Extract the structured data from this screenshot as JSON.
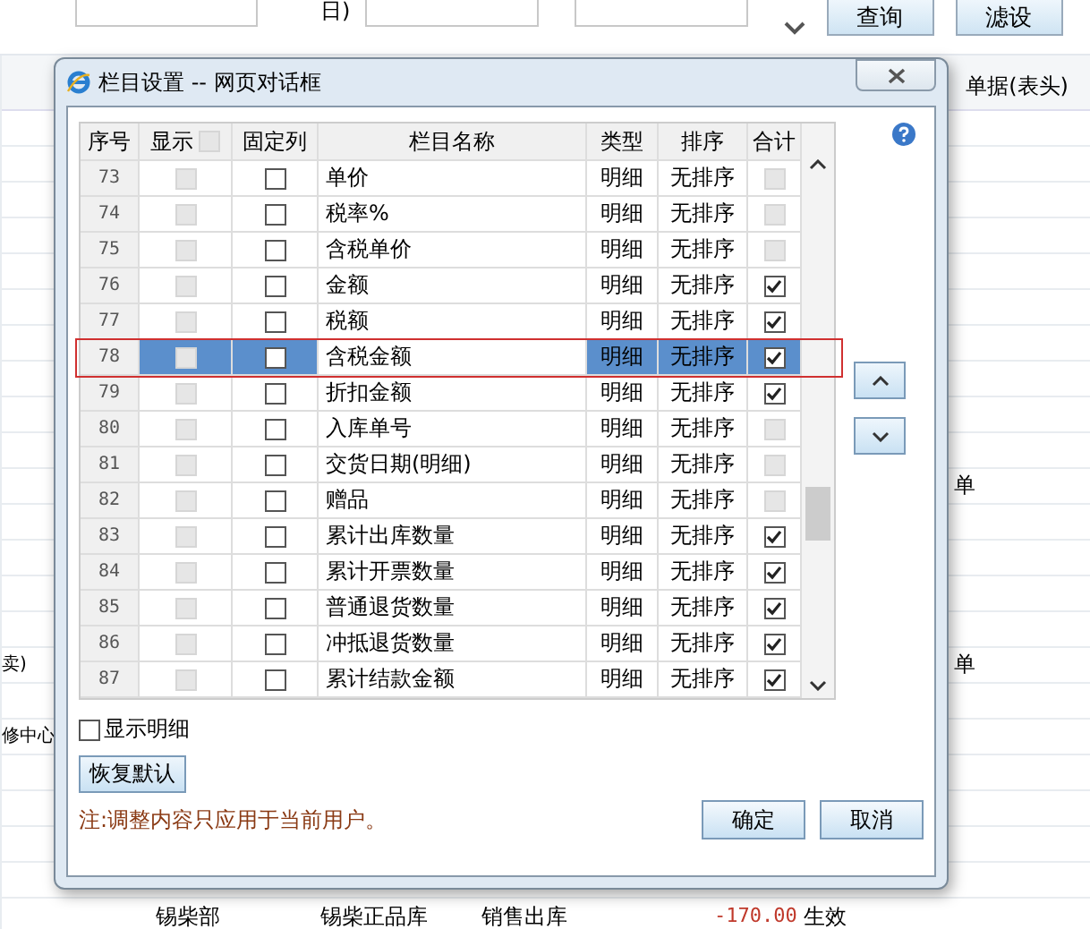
{
  "background": {
    "field_label": "日)",
    "top_buttons": [
      "查询",
      "滤设"
    ],
    "header_label": "单据(表头)",
    "rows": [
      {},
      {},
      {},
      {},
      {},
      {},
      {},
      {},
      {},
      {},
      {
        "right": "单"
      },
      {},
      {},
      {},
      {},
      {
        "left": "卖)",
        "right": "单"
      },
      {},
      {
        "left": "修中心"
      },
      {},
      {},
      {},
      {}
    ],
    "last_row": [
      "锡柴部",
      "锡柴正品库",
      "销售出库",
      "-170.00",
      "生效"
    ]
  },
  "dialog": {
    "title": "栏目设置 -- 网页对话框",
    "columns": [
      "序号",
      "显示",
      "固定列",
      "栏目名称",
      "类型",
      "排序",
      "合计"
    ],
    "show_all": {
      "checked": false,
      "disabled": true
    },
    "rows": [
      {
        "no": "73",
        "show": false,
        "show_disabled": true,
        "name": "单价",
        "type": "明细",
        "sort": "无排序",
        "fixed": false,
        "total": false,
        "total_disabled": true,
        "selected": false
      },
      {
        "no": "74",
        "show": false,
        "show_disabled": true,
        "name": "税率%",
        "type": "明细",
        "sort": "无排序",
        "fixed": false,
        "total": false,
        "total_disabled": true,
        "selected": false
      },
      {
        "no": "75",
        "show": false,
        "show_disabled": true,
        "name": "含税单价",
        "type": "明细",
        "sort": "无排序",
        "fixed": false,
        "total": false,
        "total_disabled": true,
        "selected": false
      },
      {
        "no": "76",
        "show": false,
        "show_disabled": true,
        "name": "金额",
        "type": "明细",
        "sort": "无排序",
        "fixed": false,
        "total": true,
        "total_disabled": false,
        "selected": false
      },
      {
        "no": "77",
        "show": false,
        "show_disabled": true,
        "name": "税额",
        "type": "明细",
        "sort": "无排序",
        "fixed": false,
        "total": true,
        "total_disabled": false,
        "selected": false
      },
      {
        "no": "78",
        "show": false,
        "show_disabled": true,
        "name": "含税金额",
        "type": "明细",
        "sort": "无排序",
        "fixed": false,
        "total": true,
        "total_disabled": false,
        "selected": true
      },
      {
        "no": "79",
        "show": false,
        "show_disabled": true,
        "name": "折扣金额",
        "type": "明细",
        "sort": "无排序",
        "fixed": false,
        "total": true,
        "total_disabled": false,
        "selected": false
      },
      {
        "no": "80",
        "show": false,
        "show_disabled": true,
        "name": "入库单号",
        "type": "明细",
        "sort": "无排序",
        "fixed": false,
        "total": false,
        "total_disabled": true,
        "selected": false
      },
      {
        "no": "81",
        "show": false,
        "show_disabled": true,
        "name": "交货日期(明细)",
        "type": "明细",
        "sort": "无排序",
        "fixed": false,
        "total": false,
        "total_disabled": true,
        "selected": false
      },
      {
        "no": "82",
        "show": false,
        "show_disabled": true,
        "name": "赠品",
        "type": "明细",
        "sort": "无排序",
        "fixed": false,
        "total": false,
        "total_disabled": true,
        "selected": false
      },
      {
        "no": "83",
        "show": false,
        "show_disabled": true,
        "name": "累计出库数量",
        "type": "明细",
        "sort": "无排序",
        "fixed": false,
        "total": true,
        "total_disabled": false,
        "selected": false
      },
      {
        "no": "84",
        "show": false,
        "show_disabled": true,
        "name": "累计开票数量",
        "type": "明细",
        "sort": "无排序",
        "fixed": false,
        "total": true,
        "total_disabled": false,
        "selected": false
      },
      {
        "no": "85",
        "show": false,
        "show_disabled": true,
        "name": "普通退货数量",
        "type": "明细",
        "sort": "无排序",
        "fixed": false,
        "total": true,
        "total_disabled": false,
        "selected": false
      },
      {
        "no": "86",
        "show": false,
        "show_disabled": true,
        "name": "冲抵退货数量",
        "type": "明细",
        "sort": "无排序",
        "fixed": false,
        "total": true,
        "total_disabled": false,
        "selected": false
      },
      {
        "no": "87",
        "show": false,
        "show_disabled": true,
        "name": "累计结款金额",
        "type": "明细",
        "sort": "无排序",
        "fixed": false,
        "total": true,
        "total_disabled": false,
        "selected": false
      }
    ],
    "show_detail": {
      "label": "显示明细",
      "checked": false
    },
    "reset_button": "恢复默认",
    "note": "注:调整内容只应用于当前用户。",
    "ok_button": "确定",
    "cancel_button": "取消"
  }
}
